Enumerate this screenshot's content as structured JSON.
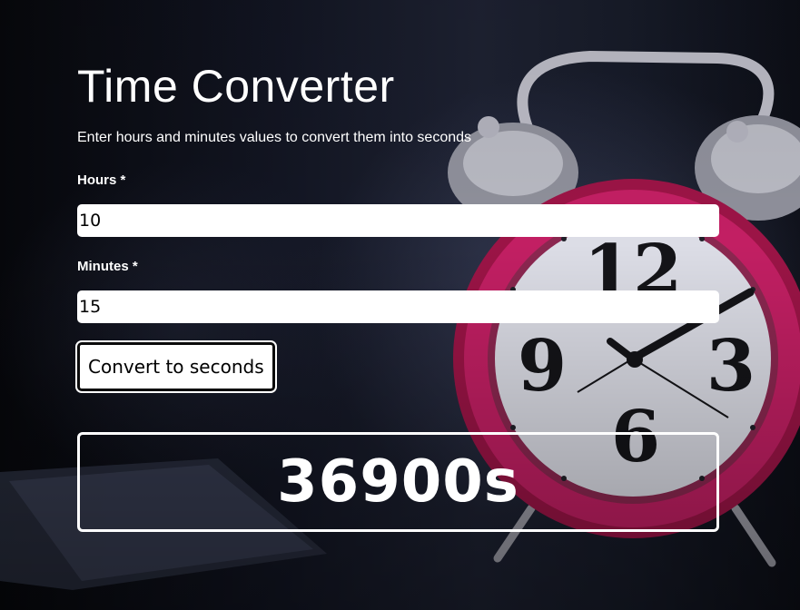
{
  "page": {
    "title": "Time Converter",
    "subtitle": "Enter hours and minutes values to convert them into seconds"
  },
  "form": {
    "hours": {
      "label": "Hours *",
      "value": "10"
    },
    "minutes": {
      "label": "Minutes *",
      "value": "15"
    },
    "convert_button_label": "Convert to seconds"
  },
  "result": {
    "value": "36900s"
  },
  "background": {
    "scene": "alarm-clock-photo",
    "clock_numerals": [
      "12",
      "3",
      "6",
      "9"
    ],
    "clock_rim_color": "#c21f63",
    "clock_face_color": "#dcdde6",
    "backdrop_color": "#161a27"
  }
}
